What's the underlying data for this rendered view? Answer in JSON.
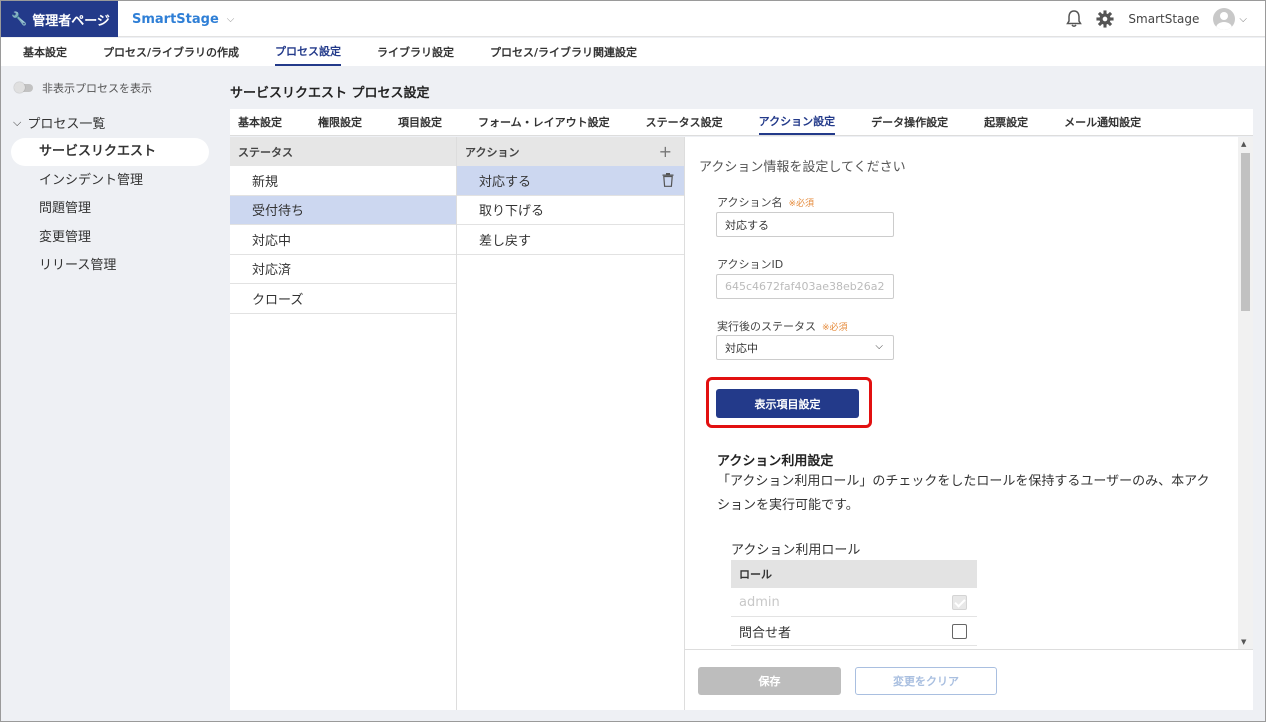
{
  "header": {
    "admin_label": "管理者ページ",
    "app_name": "SmartStage",
    "user_name": "SmartStage"
  },
  "topnav": {
    "tabs": [
      {
        "label": "基本設定"
      },
      {
        "label": "プロセス/ライブラリの作成"
      },
      {
        "label": "プロセス設定"
      },
      {
        "label": "ライブラリ設定"
      },
      {
        "label": "プロセス/ライブラリ関連設定"
      }
    ],
    "active": "プロセス設定"
  },
  "sidebar": {
    "toggle_label": "非表示プロセスを表示",
    "section_label": "プロセス一覧",
    "items": [
      {
        "label": "サービスリクエスト"
      },
      {
        "label": "インシデント管理"
      },
      {
        "label": "問題管理"
      },
      {
        "label": "変更管理"
      },
      {
        "label": "リリース管理"
      }
    ]
  },
  "main": {
    "page_title": "サービスリクエスト プロセス設定",
    "subtabs": [
      {
        "label": "基本設定"
      },
      {
        "label": "権限設定"
      },
      {
        "label": "項目設定"
      },
      {
        "label": "フォーム・レイアウト設定"
      },
      {
        "label": "ステータス設定"
      },
      {
        "label": "アクション設定"
      },
      {
        "label": "データ操作設定"
      },
      {
        "label": "起票設定"
      },
      {
        "label": "メール通知設定"
      }
    ],
    "active_subtab": "アクション設定"
  },
  "status_column": {
    "header": "ステータス",
    "rows": [
      "新規",
      "受付待ち",
      "対応中",
      "対応済",
      "クローズ"
    ]
  },
  "action_column": {
    "header": "アクション",
    "add_symbol": "+",
    "rows": [
      "対応する",
      "取り下げる",
      "差し戻す"
    ]
  },
  "detail": {
    "info_title": "アクション情報を設定してください",
    "action_name_label": "アクション名",
    "required_mark": "※必須",
    "action_name_value": "対応する",
    "action_id_label": "アクションID",
    "action_id_value": "645c4672faf403ae38eb26a2",
    "post_status_label": "実行後のステータス",
    "post_status_value": "対応中",
    "display_items_button": "表示項目設定",
    "usage_title": "アクション利用設定",
    "usage_desc": "「アクション利用ロール」のチェックをしたロールを保持するユーザーのみ、本アクションを実行可能です。",
    "role_title": "アクション利用ロール",
    "role_header": "ロール",
    "roles": [
      {
        "name": "admin",
        "checked": true,
        "disabled": true
      },
      {
        "name": "問合せ者",
        "checked": false,
        "disabled": false
      }
    ],
    "save_button": "保存",
    "clear_button": "変更をクリア"
  },
  "colors": {
    "brand": "#233a8a",
    "link": "#2f7fd6",
    "selected_row": "#ccd7f0",
    "highlight": "#e21010",
    "required": "#e58a3a"
  }
}
